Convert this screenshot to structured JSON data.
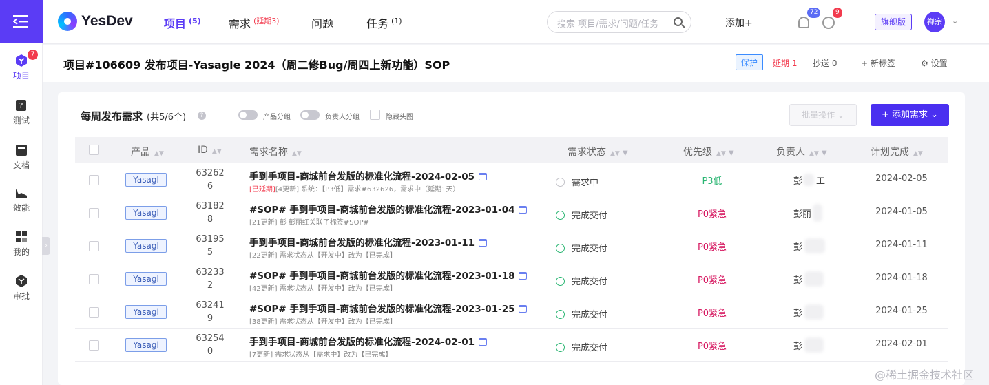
{
  "sidebar": {
    "items": [
      {
        "label": "项目",
        "badge": "7"
      },
      {
        "label": "测试"
      },
      {
        "label": "文档"
      },
      {
        "label": "效能"
      },
      {
        "label": "我的"
      },
      {
        "label": "审批"
      }
    ]
  },
  "header": {
    "logo_text": "YesDev",
    "nav": [
      {
        "label": "项目",
        "sup": "(5)"
      },
      {
        "label": "需求",
        "sup": "(延期3)"
      },
      {
        "label": "问题",
        "sup": ""
      },
      {
        "label": "任务",
        "sup": "(1)"
      }
    ],
    "search_placeholder": "搜索 项目/需求/问题/任务",
    "add_label": "添加+",
    "bell_badge": "72",
    "clock_badge": "9",
    "edition": "旗舰版",
    "avatar_text": "禅宗"
  },
  "project": {
    "title": "项目#106609 发布项目-Yasagle 2024（周二修Bug/周四上新功能）SOP",
    "protect_tag": "保护",
    "delay_label": "延期",
    "delay_count": "1",
    "cc_label": "抄送 0",
    "new_tag": "+ 新标签",
    "settings": "设置"
  },
  "card": {
    "title": "每周发布需求",
    "count": "(共5/6个)",
    "help": "?",
    "toggle_product": "产品分组",
    "toggle_owner": "负责人分组",
    "hide_header": "隐藏头图",
    "batch_btn": "批量操作 ⌄",
    "add_btn": "+ 添加需求 ⌄"
  },
  "table": {
    "columns": [
      "产品",
      "ID",
      "需求名称",
      "需求状态",
      "优先级",
      "负责人",
      "计划完成"
    ],
    "rows": [
      {
        "product": "Yasagl",
        "id_line1": "63262",
        "id_line2": "6",
        "name": "手到手项目-商城前台发版的标准化流程-2024-02-05",
        "sub_red": "[已延期]",
        "sub": "[4更新] 系统：【P3低】需求#632626，需求中（延期1天）",
        "status": "需求中",
        "status_kind": "pending",
        "priority": "P3低",
        "priority_color": "#2bb673",
        "owner": "彭",
        "owner_tail": "工",
        "date": "2024-02-05"
      },
      {
        "product": "Yasagl",
        "id_line1": "63182",
        "id_line2": "8",
        "name": "#SOP# 手到手项目-商城前台发版的标准化流程-2023-01-04",
        "sub_red": "",
        "sub": "[21更新] 彭            彭丽红关联了标签#SOP#",
        "status": "完成交付",
        "status_kind": "done",
        "priority": "P0紧急",
        "priority_color": "#d6165f",
        "owner": "彭丽",
        "owner_tail": "",
        "date": "2024-01-05"
      },
      {
        "product": "Yasagl",
        "id_line1": "63195",
        "id_line2": "5",
        "name": "手到手项目-商城前台发版的标准化流程-2023-01-11",
        "sub_red": "",
        "sub": "[22更新]           需求状态从【开发中】改为【已完成】",
        "status": "完成交付",
        "status_kind": "done",
        "priority": "P0紧急",
        "priority_color": "#d6165f",
        "owner": "彭",
        "owner_tail": "",
        "date": "2024-01-11"
      },
      {
        "product": "Yasagl",
        "id_line1": "63233",
        "id_line2": "2",
        "name": "#SOP# 手到手项目-商城前台发版的标准化流程-2023-01-18",
        "sub_red": "",
        "sub": "[42更新]           需求状态从【开发中】改为【已完成】",
        "status": "完成交付",
        "status_kind": "done",
        "priority": "P0紧急",
        "priority_color": "#d6165f",
        "owner": "彭",
        "owner_tail": "",
        "date": "2024-01-18"
      },
      {
        "product": "Yasagl",
        "id_line1": "63241",
        "id_line2": "9",
        "name": "#SOP# 手到手项目-商城前台发版的标准化流程-2023-01-25",
        "sub_red": "",
        "sub": "[38更新]           需求状态从【开发中】改为【已完成】",
        "status": "完成交付",
        "status_kind": "done",
        "priority": "P0紧急",
        "priority_color": "#d6165f",
        "owner": "彭",
        "owner_tail": "",
        "date": "2024-01-25"
      },
      {
        "product": "Yasagl",
        "id_line1": "63254",
        "id_line2": "0",
        "name": "手到手项目-商城前台发版的标准化流程-2024-02-01",
        "sub_red": "",
        "sub": "[7更新]           需求状态从【需求中】改为【已完成】",
        "status": "完成交付",
        "status_kind": "done",
        "priority": "P0紧急",
        "priority_color": "#d6165f",
        "owner": "彭",
        "owner_tail": "",
        "date": "2024-02-01"
      }
    ]
  },
  "watermark": "@稀土掘金技术社区",
  "colors": {
    "accent": "#5b3cf5",
    "danger": "#f23b4e",
    "success": "#2bb673",
    "p0": "#d6165f"
  }
}
